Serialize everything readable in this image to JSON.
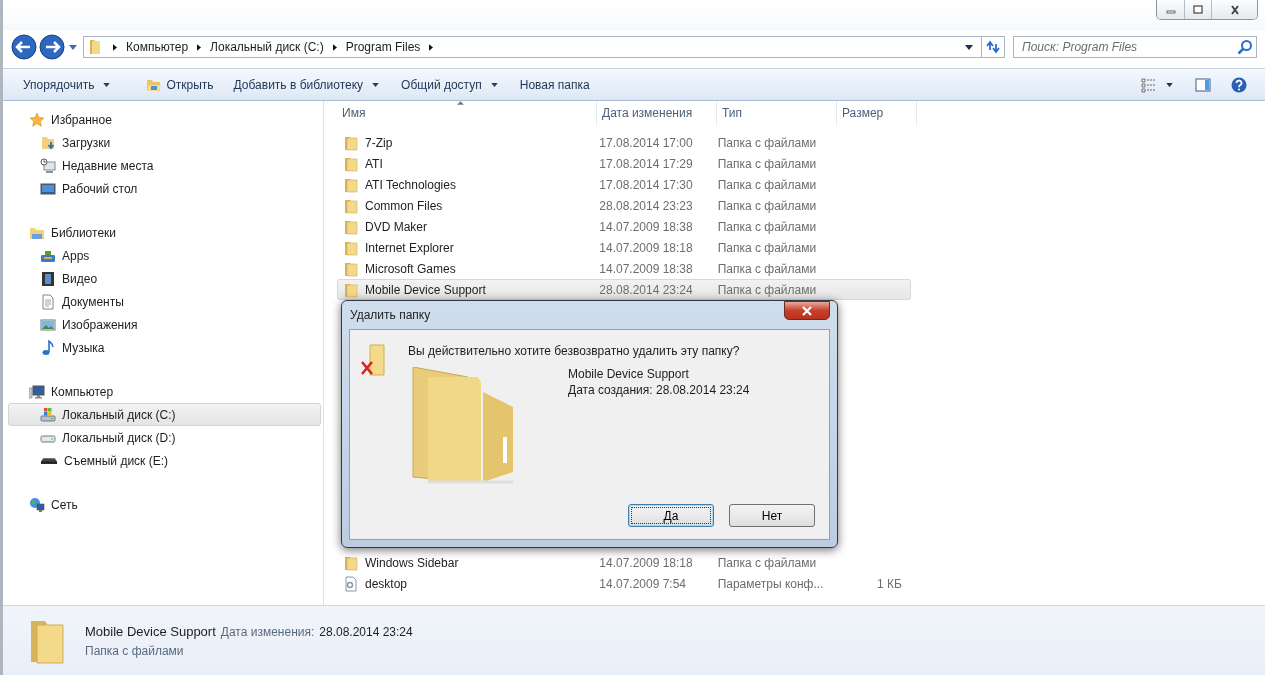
{
  "address_bar": {
    "crumbs": [
      "Компьютер",
      "Локальный диск (C:)",
      "Program Files"
    ]
  },
  "search": {
    "placeholder": "Поиск: Program Files"
  },
  "toolbar": {
    "buttons": [
      {
        "label": "Упорядочить",
        "kind": "menu"
      },
      {
        "label": "Открыть",
        "kind": "open"
      },
      {
        "label": "Добавить в библиотеку",
        "kind": "menu"
      },
      {
        "label": "Общий доступ",
        "kind": "menu"
      },
      {
        "label": "Новая папка",
        "kind": "plain"
      }
    ]
  },
  "sidebar": {
    "sections": [
      {
        "label": "Избранное",
        "kind": "favorites",
        "children": [
          {
            "label": "Загрузки",
            "kind": "downloads",
            "selected": false
          },
          {
            "label": "Недавние места",
            "kind": "recent",
            "selected": false
          },
          {
            "label": "Рабочий стол",
            "kind": "desktop",
            "selected": false
          }
        ]
      },
      {
        "label": "Библиотеки",
        "kind": "libraries",
        "children": [
          {
            "label": "Apps",
            "kind": "apps",
            "selected": false
          },
          {
            "label": "Видео",
            "kind": "video",
            "selected": false
          },
          {
            "label": "Документы",
            "kind": "documents",
            "selected": false
          },
          {
            "label": "Изображения",
            "kind": "pictures",
            "selected": false
          },
          {
            "label": "Музыка",
            "kind": "music",
            "selected": false
          }
        ]
      },
      {
        "label": "Компьютер",
        "kind": "computer",
        "children": [
          {
            "label": "Локальный диск (C:)",
            "kind": "system-drive",
            "selected": true
          },
          {
            "label": "Локальный диск (D:)",
            "kind": "drive",
            "selected": false
          },
          {
            "label": "Съемный диск (E:)",
            "kind": "removable",
            "selected": false
          }
        ]
      },
      {
        "label": "Сеть",
        "kind": "network"
      }
    ]
  },
  "table": {
    "columns": [
      "Имя",
      "Дата изменения",
      "Тип",
      "Размер"
    ],
    "groups": [
      {
        "rows": [
          {
            "name": "7-Zip",
            "date": "17.08.2014 17:00",
            "type": "Папка с файлами",
            "kind": "folder",
            "selected": false
          },
          {
            "name": "ATI",
            "date": "17.08.2014 17:29",
            "type": "Папка с файлами",
            "kind": "folder",
            "selected": false
          },
          {
            "name": "ATI Technologies",
            "date": "17.08.2014 17:30",
            "type": "Папка с файлами",
            "kind": "folder",
            "selected": false
          },
          {
            "name": "Common Files",
            "date": "28.08.2014 23:23",
            "type": "Папка с файлами",
            "kind": "folder",
            "selected": false
          },
          {
            "name": "DVD Maker",
            "date": "14.07.2009 18:38",
            "type": "Папка с файлами",
            "kind": "folder",
            "selected": false
          },
          {
            "name": "Internet Explorer",
            "date": "14.07.2009 18:18",
            "type": "Папка с файлами",
            "kind": "folder",
            "selected": false
          },
          {
            "name": "Microsoft Games",
            "date": "14.07.2009 18:38",
            "type": "Папка с файлами",
            "kind": "folder",
            "selected": false
          },
          {
            "name": "Mobile Device Support",
            "date": "28.08.2014 23:24",
            "type": "Папка с файлами",
            "kind": "folder",
            "selected": true
          }
        ]
      },
      {
        "rows": [
          {
            "name": "Windows Sidebar",
            "date": "14.07.2009 18:18",
            "type": "Папка с файлами",
            "kind": "folder",
            "selected": false
          },
          {
            "name": "desktop",
            "date": "14.07.2009 7:54",
            "type": "Параметры конф...",
            "size": "1 КБ",
            "kind": "file",
            "selected": false
          }
        ]
      }
    ]
  },
  "details_pane": {
    "name": "Mobile Device Support",
    "date_label": "Дата изменения:",
    "date": "28.08.2014 23:24",
    "type": "Папка с файлами"
  },
  "dialog": {
    "title": "Удалить папку",
    "message": "Вы действительно хотите безвозвратно удалить эту папку?",
    "item_name": "Mobile Device Support",
    "item_date": "Дата создания: 28.08.2014 23:24",
    "buttons": [
      {
        "label": "Да",
        "default": true
      },
      {
        "label": "Нет",
        "default": false
      }
    ]
  }
}
